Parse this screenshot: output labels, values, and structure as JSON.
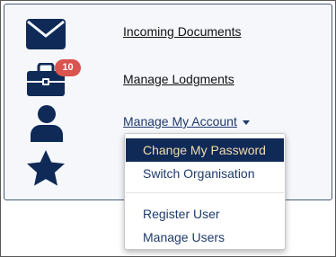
{
  "nav": {
    "incoming_documents": "Incoming Documents",
    "manage_lodgments": "Manage Lodgments",
    "manage_my_account": "Manage My Account"
  },
  "badge": {
    "count": "10"
  },
  "dropdown": {
    "items": [
      {
        "label": "Change My Password",
        "active": true
      },
      {
        "label": "Switch Organisation",
        "active": false
      },
      {
        "label": "Register User",
        "active": false
      },
      {
        "label": "Manage Users",
        "active": false
      }
    ]
  },
  "icons": {
    "mail": "envelope-icon",
    "briefcase": "briefcase-icon",
    "account": "user-icon",
    "favourites": "star-icon"
  },
  "colors": {
    "icon": "#0f2a57",
    "badge": "#d9534f",
    "active_bg": "#0f2a57",
    "active_text": "#f3dcae",
    "menu_text": "#1f3a6b"
  }
}
